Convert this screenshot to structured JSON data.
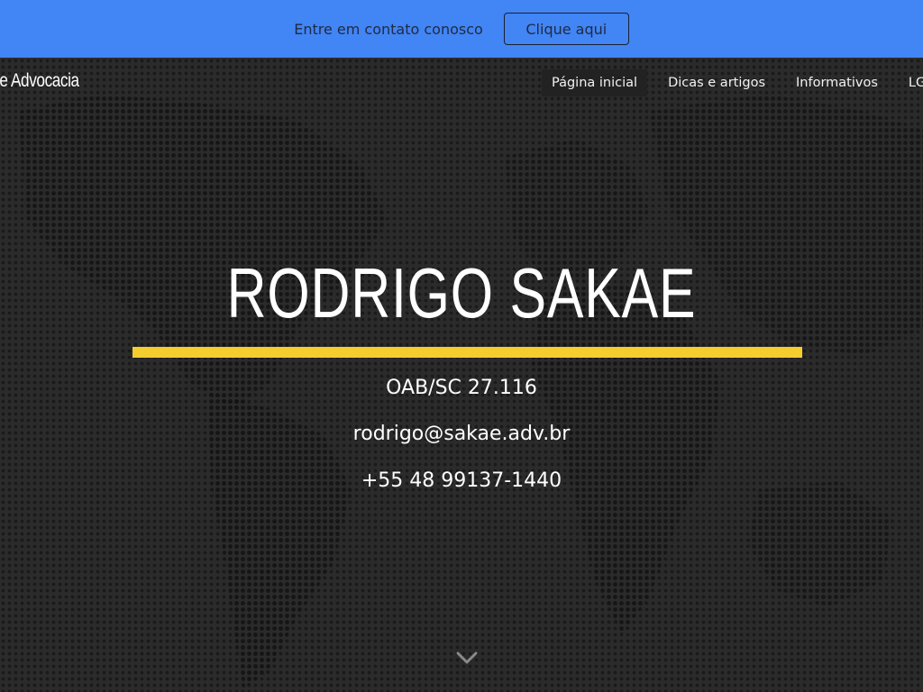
{
  "topbar": {
    "text": "Entre em contato conosco",
    "button_label": "Clique aqui",
    "background_color": "#4285f4"
  },
  "navbar": {
    "brand": "kae Advocacia",
    "links": [
      {
        "label": "Página inicial",
        "active": true
      },
      {
        "label": "Dicas e artigos",
        "active": false
      },
      {
        "label": "Informativos",
        "active": false
      },
      {
        "label": "LG",
        "active": false
      }
    ]
  },
  "hero": {
    "title": "RODRIGO SAKAE",
    "accent_color": "#f5cd2f",
    "oab": "OAB/SC 27.116",
    "email": "rodrigo@sakae.adv.br",
    "phone": "+55 48 99137-1440",
    "scroll_icon": "chevron-down-icon"
  }
}
